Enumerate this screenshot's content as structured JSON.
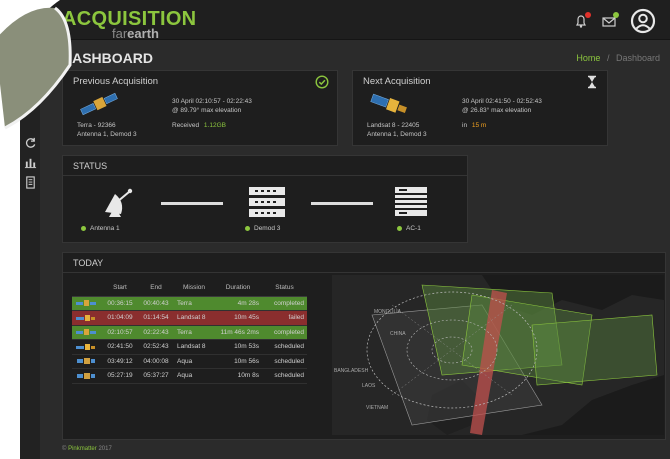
{
  "app": {
    "logo_main": "ACQUISITION",
    "logo_sub_prefix": "far",
    "logo_sub_bold": "earth"
  },
  "header": {
    "page_title": "DASHBOARD",
    "breadcrumb_home": "Home",
    "breadcrumb_sep": "/",
    "breadcrumb_current": "Dashboard"
  },
  "colors": {
    "accent_green": "#8cc63e",
    "failed_red": "#8a2e2e",
    "completed_green": "#4f8a2e",
    "warning_orange": "#f0a020",
    "notification_red": "#e0312b"
  },
  "previous": {
    "title": "Previous Acquisition",
    "sat_line": "Terra - 92366",
    "antenna_line": "Antenna 1, Demod 3",
    "time_line": "30 April 02:10:57 - 02:22:43",
    "elevation_line": "@ 89.79° max elevation",
    "received_label": "Received",
    "received_value": "1.12GB",
    "status_icon": "check-circle-icon"
  },
  "next": {
    "title": "Next Acquisition",
    "sat_line": "Landsat 8 - 22405",
    "antenna_line": "Antenna 1, Demod 3",
    "time_line": "30 April 02:41:50 - 02:52:43",
    "elevation_line": "@ 26.83° max elevation",
    "in_label": "in",
    "in_value": "15 m",
    "status_icon": "hourglass-icon"
  },
  "status": {
    "title": "STATUS",
    "nodes": [
      {
        "label": "Antenna 1",
        "icon": "satellite-dish-icon"
      },
      {
        "label": "Demod 3",
        "icon": "server-icon"
      },
      {
        "label": "AC-1",
        "icon": "server-rack-icon"
      }
    ]
  },
  "today": {
    "title": "TODAY",
    "columns": [
      "Start",
      "End",
      "Mission",
      "Duration",
      "Status"
    ],
    "rows": [
      {
        "start": "00:36:15",
        "end": "00:40:43",
        "mission": "Terra",
        "duration": "4m 28s",
        "status": "completed",
        "kind": "completed"
      },
      {
        "start": "01:04:09",
        "end": "01:14:54",
        "mission": "Landsat 8",
        "duration": "10m 45s",
        "status": "failed",
        "kind": "failed"
      },
      {
        "start": "02:10:57",
        "end": "02:22:43",
        "mission": "Terra",
        "duration": "11m 46s 2ms",
        "status": "completed",
        "kind": "completed"
      },
      {
        "start": "02:41:50",
        "end": "02:52:43",
        "mission": "Landsat 8",
        "duration": "10m 53s",
        "status": "scheduled",
        "kind": "scheduled"
      },
      {
        "start": "03:49:12",
        "end": "04:00:08",
        "mission": "Aqua",
        "duration": "10m 56s",
        "status": "scheduled",
        "kind": "scheduled"
      },
      {
        "start": "05:27:19",
        "end": "05:37:27",
        "mission": "Aqua",
        "duration": "10m 8s",
        "status": "scheduled",
        "kind": "scheduled"
      }
    ]
  },
  "map": {
    "labels": [
      "MONGOLIA",
      "CHINA",
      "LAOS",
      "VIETNAM",
      "BANGLADESH"
    ]
  },
  "footer": {
    "prefix": "©",
    "brand": "Pinkmatter",
    "year": "2017"
  }
}
